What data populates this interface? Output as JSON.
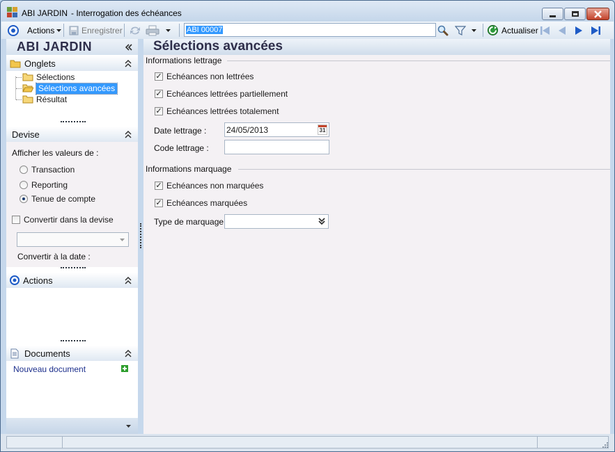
{
  "window": {
    "app_name": "ABI JARDIN",
    "title": "- Interrogation des échéances"
  },
  "toolbar": {
    "actions_label": "Actions",
    "save_label": "Enregistrer",
    "record_value": "ABI 00007",
    "refresh_label": "Actualiser"
  },
  "sidebar": {
    "company_name": "ABI JARDIN",
    "onglets": {
      "title": "Onglets",
      "items": [
        {
          "label": "Sélections"
        },
        {
          "label": "Sélections avancées",
          "selected": true
        },
        {
          "label": "Résultat"
        }
      ]
    },
    "devise": {
      "title": "Devise",
      "values_label": "Afficher les valeurs de :",
      "options": [
        {
          "label": "Transaction",
          "checked": false
        },
        {
          "label": "Reporting",
          "checked": false
        },
        {
          "label": "Tenue de compte",
          "checked": true
        }
      ],
      "convert_label": "Convertir dans la devise",
      "convert_date_label": "Convertir à la date :"
    },
    "actions": {
      "title": "Actions"
    },
    "documents": {
      "title": "Documents",
      "new_document": "Nouveau document"
    }
  },
  "main": {
    "title": "Sélections avancées",
    "lettrage": {
      "group_title": "Informations lettrage",
      "options": [
        {
          "label": "Echéances non lettrées",
          "checked": true
        },
        {
          "label": "Echéances lettrées partiellement",
          "checked": true
        },
        {
          "label": "Echéances lettrées totalement",
          "checked": true
        }
      ],
      "date_label": "Date lettrage :",
      "date_value": "24/05/2013",
      "calendar_day": "31",
      "code_label": "Code lettrage :",
      "code_value": ""
    },
    "marquage": {
      "group_title": "Informations marquage",
      "options": [
        {
          "label": "Echéances non marquées",
          "checked": true
        },
        {
          "label": "Echéances marquées",
          "checked": true
        }
      ],
      "type_label": "Type de marquage :",
      "type_value": ""
    }
  },
  "colors": {
    "selection": "#3399ff",
    "accent_blue": "#1e5bc6",
    "add_green": "#2e9e2e"
  }
}
